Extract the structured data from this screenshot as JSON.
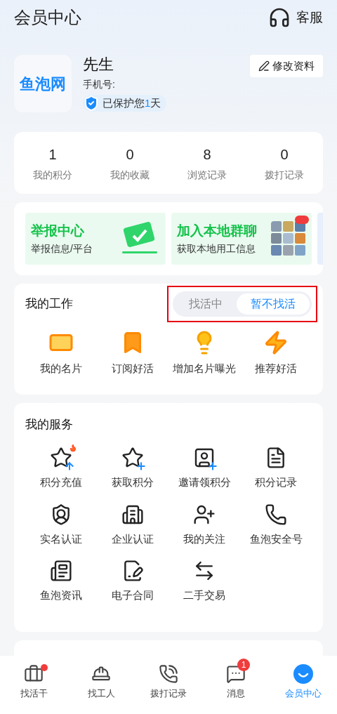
{
  "header": {
    "title": "会员中心",
    "service_label": "客服"
  },
  "profile": {
    "logo_text": "鱼泡网",
    "name": "先生",
    "phone_label": "手机号:",
    "protect_prefix": "已保护您",
    "protect_days": "1",
    "protect_suffix": "天",
    "edit_label": "修改资料"
  },
  "stats": [
    {
      "value": "1",
      "label": "我的积分"
    },
    {
      "value": "0",
      "label": "我的收藏"
    },
    {
      "value": "8",
      "label": "浏览记录"
    },
    {
      "value": "0",
      "label": "拨打记录"
    }
  ],
  "banners": [
    {
      "kind": "check",
      "title": "举报中心",
      "subtitle": "举报信息/平台"
    },
    {
      "kind": "photos",
      "title": "加入本地群聊",
      "subtitle": "获取本地用工信息"
    }
  ],
  "work": {
    "title": "我的工作",
    "highlighted": true,
    "toggle": [
      {
        "label": "找活中",
        "selected": false
      },
      {
        "label": "暂不找活",
        "selected": true
      }
    ],
    "items": [
      {
        "kind": "card",
        "label": "我的名片"
      },
      {
        "kind": "ribbon",
        "label": "订阅好活"
      },
      {
        "kind": "bulb",
        "label": "增加名片曝光"
      },
      {
        "kind": "bolt",
        "label": "推荐好活"
      }
    ]
  },
  "services": {
    "title": "我的服务",
    "items": [
      {
        "kind": "recharge",
        "label": "积分充值",
        "hot": true
      },
      {
        "kind": "earn",
        "label": "获取积分",
        "hot": false
      },
      {
        "kind": "invite",
        "label": "邀请领积分",
        "hot": false
      },
      {
        "kind": "record",
        "label": "积分记录",
        "hot": false
      },
      {
        "kind": "realname",
        "label": "实名认证",
        "hot": false
      },
      {
        "kind": "company",
        "label": "企业认证",
        "hot": false
      },
      {
        "kind": "follow",
        "label": "我的关注",
        "hot": false
      },
      {
        "kind": "security",
        "label": "鱼泡安全号",
        "hot": false
      },
      {
        "kind": "news",
        "label": "鱼泡资讯",
        "hot": false
      },
      {
        "kind": "contract",
        "label": "电子合同",
        "hot": false
      },
      {
        "kind": "trade",
        "label": "二手交易",
        "hot": false
      }
    ]
  },
  "welfare": {
    "kind": "card"
  },
  "tabs": [
    {
      "kind": "jobs",
      "label": "找活干",
      "selected": false,
      "dot": true
    },
    {
      "kind": "workers",
      "label": "找工人",
      "selected": false,
      "dot": false
    },
    {
      "kind": "calls",
      "label": "拨打记录",
      "selected": false,
      "dot": false
    },
    {
      "kind": "messages",
      "label": "消息",
      "selected": false,
      "dot": false,
      "count": "1"
    },
    {
      "kind": "member",
      "label": "会员中心",
      "selected": true,
      "dot": false
    }
  ]
}
